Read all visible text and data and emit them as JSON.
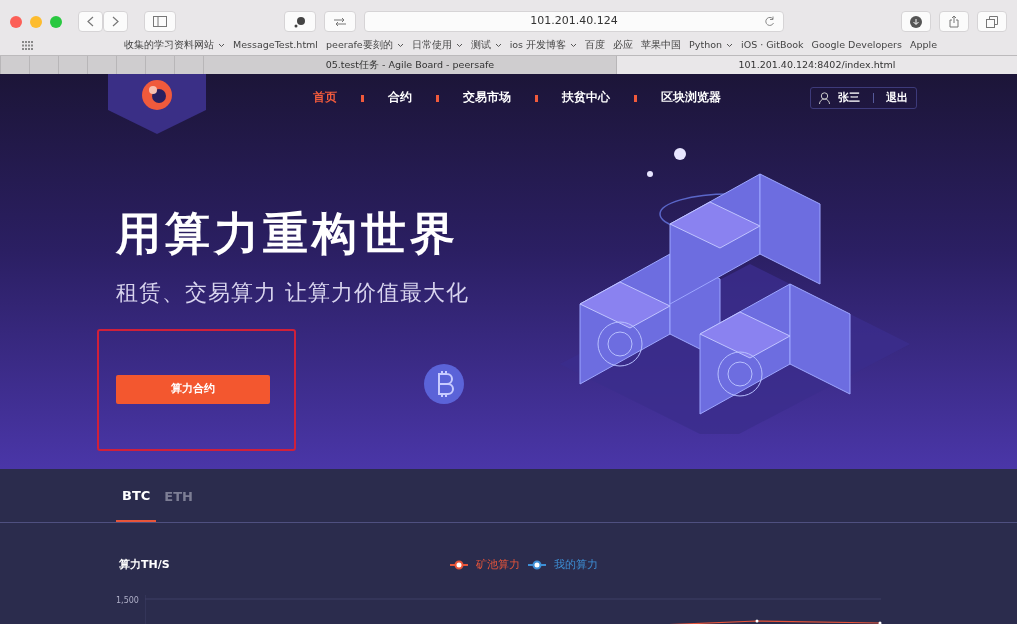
{
  "window": {
    "url": "101.201.40.124",
    "bookmarks": [
      {
        "label": "收集的学习资料网站",
        "dropdown": true
      },
      {
        "label": "MessageTest.html",
        "dropdown": false
      },
      {
        "label": "peerafe要刻的",
        "dropdown": true
      },
      {
        "label": "日常使用",
        "dropdown": true
      },
      {
        "label": "测试",
        "dropdown": true
      },
      {
        "label": "ios 开发博客",
        "dropdown": true
      },
      {
        "label": "百度",
        "dropdown": false
      },
      {
        "label": "必应",
        "dropdown": false
      },
      {
        "label": "苹果中国",
        "dropdown": false
      },
      {
        "label": "Python",
        "dropdown": true
      },
      {
        "label": "iOS · GitBook",
        "dropdown": false
      },
      {
        "label": "Google Developers",
        "dropdown": false
      },
      {
        "label": "Apple",
        "dropdown": false
      }
    ],
    "tabs": [
      {
        "label": "05.test任务 - Agile Board - peersafe",
        "selected": false
      },
      {
        "label": "101.201.40.124:8402/index.html",
        "selected": true
      }
    ]
  },
  "nav": {
    "items": [
      {
        "label": "首页",
        "selected": true
      },
      {
        "label": "合约",
        "selected": false
      },
      {
        "label": "交易市场",
        "selected": false
      },
      {
        "label": "扶贫中心",
        "selected": false
      },
      {
        "label": "区块浏览器",
        "selected": false
      }
    ],
    "user": {
      "name": "张三",
      "logout": "退出"
    }
  },
  "hero": {
    "title": "用算力重构世界",
    "subtitle": "租赁、交易算力 让算力价值最大化",
    "button": "算力合约"
  },
  "coin_tabs": [
    {
      "label": "BTC",
      "selected": true
    },
    {
      "label": "ETH",
      "selected": false
    }
  ],
  "chart": {
    "title": "算力TH/S",
    "y_label": "1,500",
    "legend": [
      {
        "label": "矿池算力",
        "color": "#e8553a"
      },
      {
        "label": "我的算力",
        "color": "#3d8fd6"
      }
    ]
  }
}
